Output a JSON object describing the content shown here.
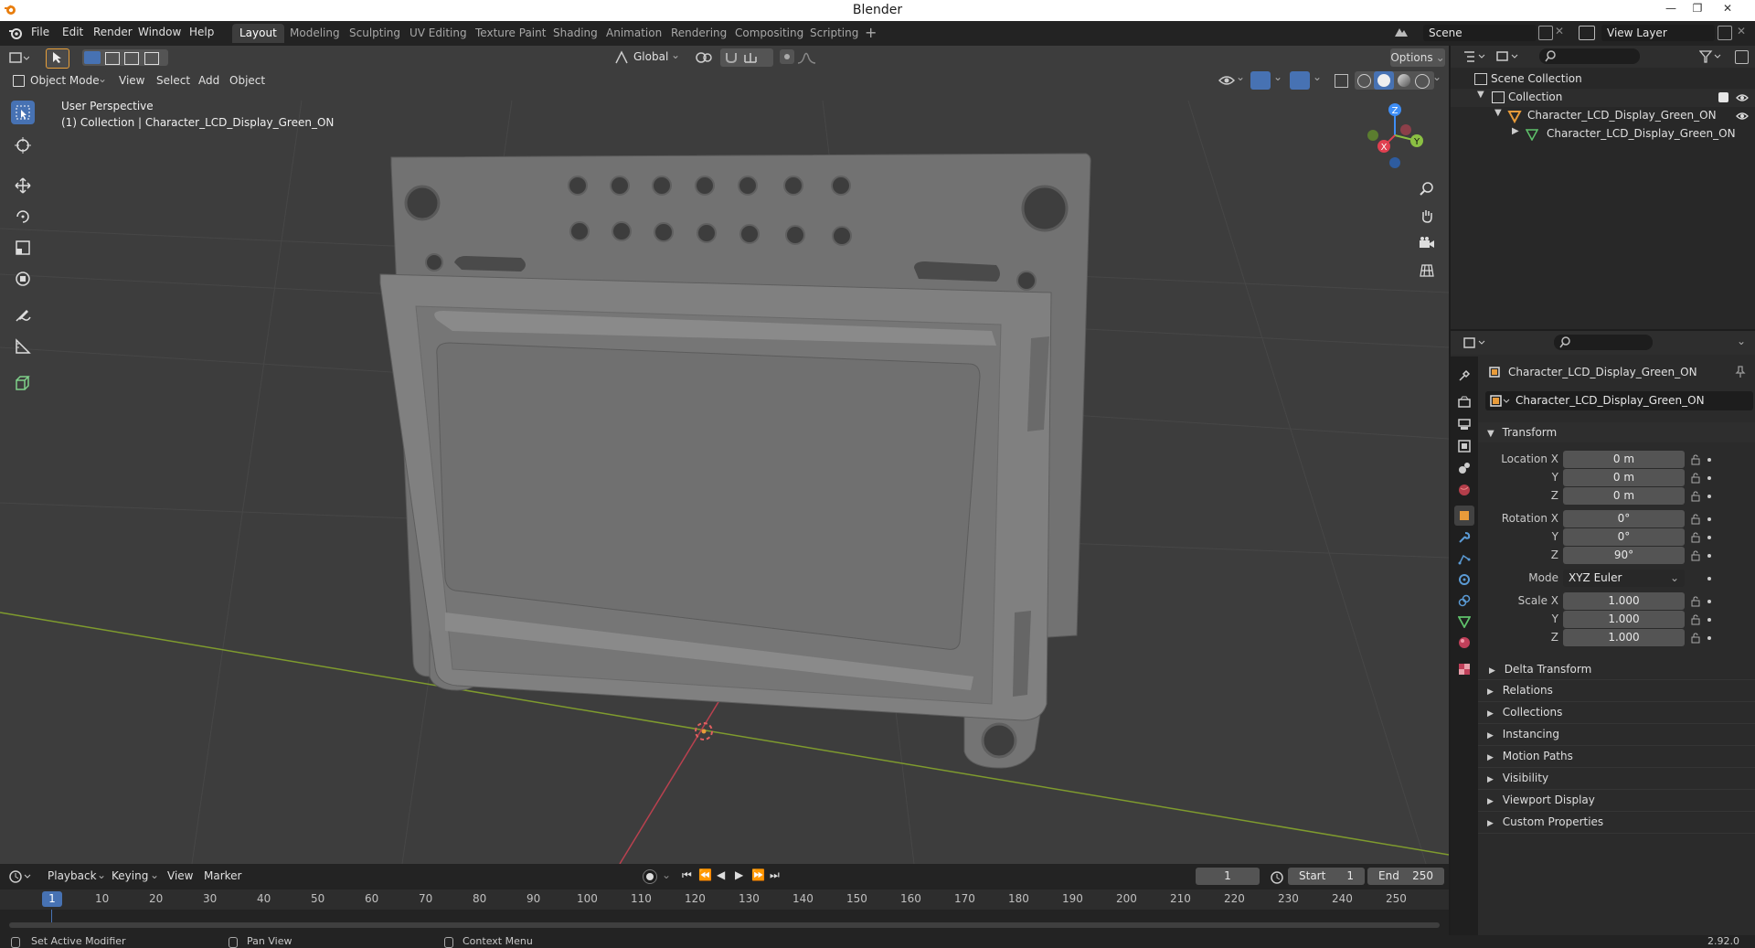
{
  "window": {
    "title": "Blender"
  },
  "menus": [
    "File",
    "Edit",
    "Render",
    "Window",
    "Help"
  ],
  "workspaces": [
    "Layout",
    "Modeling",
    "Sculpting",
    "UV Editing",
    "Texture Paint",
    "Shading",
    "Animation",
    "Rendering",
    "Compositing",
    "Scripting"
  ],
  "active_workspace": "Layout",
  "scene": {
    "name": "Scene",
    "view_layer": "View Layer"
  },
  "viewport": {
    "orientation": "Global",
    "options_label": "Options",
    "mode": "Object Mode",
    "menus": [
      "View",
      "Select",
      "Add",
      "Object"
    ],
    "overlay_title": "User Perspective",
    "overlay_subtitle": "(1) Collection | Character_LCD_Display_Green_ON",
    "gizmo": {
      "x": "X",
      "y": "Y",
      "z": "Z"
    }
  },
  "outliner": {
    "scene_collection": "Scene Collection",
    "collection": "Collection",
    "object": "Character_LCD_Display_Green_ON",
    "mesh": "Character_LCD_Display_Green_ON"
  },
  "properties": {
    "object_name": "Character_LCD_Display_Green_ON",
    "data_name": "Character_LCD_Display_Green_ON",
    "transform_label": "Transform",
    "location": {
      "label": "Location X",
      "x": "0 m",
      "y": "0 m",
      "z": "0 m"
    },
    "rotation": {
      "label": "Rotation X",
      "x": "0°",
      "y": "0°",
      "z": "90°"
    },
    "mode": {
      "label": "Mode",
      "value": "XYZ Euler"
    },
    "scale": {
      "label": "Scale X",
      "x": "1.000",
      "y": "1.000",
      "z": "1.000"
    },
    "axis_y": "Y",
    "axis_z": "Z",
    "delta_transform": "Delta Transform",
    "panels": [
      "Relations",
      "Collections",
      "Instancing",
      "Motion Paths",
      "Visibility",
      "Viewport Display",
      "Custom Properties"
    ]
  },
  "timeline": {
    "menus": [
      "Playback",
      "Keying",
      "View",
      "Marker"
    ],
    "current_frame": "1",
    "start_label": "Start",
    "start": "1",
    "end_label": "End",
    "end": "250",
    "ruler_marker": "1",
    "ruler": [
      "10",
      "20",
      "30",
      "40",
      "50",
      "60",
      "70",
      "80",
      "90",
      "100",
      "110",
      "120",
      "130",
      "140",
      "150",
      "160",
      "170",
      "180",
      "190",
      "200",
      "210",
      "220",
      "230",
      "240",
      "250"
    ]
  },
  "statusbar": {
    "left": "Set Active Modifier",
    "mid": "Pan View",
    "right": "Context Menu",
    "version": "2.92.0"
  },
  "colors": {
    "accent": "#4772b3",
    "x_axis": "#e04050",
    "y_axis": "#8bc043",
    "z_axis": "#3e8ef7",
    "object_orange": "#e89b3a",
    "mesh_green": "#5fc26b"
  }
}
